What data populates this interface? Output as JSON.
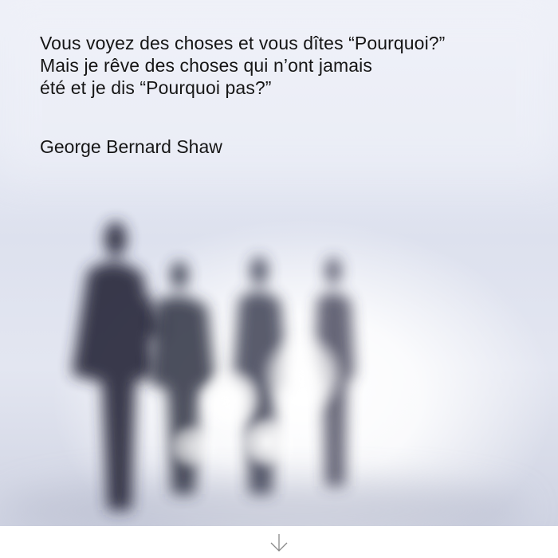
{
  "quote": {
    "lines": [
      "Vous voyez des choses et vous dîtes “Pourquoi?”",
      "Mais je rêve des choses qui n’ont jamais",
      "été et je dis “Pourquoi pas?”"
    ],
    "author": "George Bernard Shaw"
  },
  "icons": {
    "scroll": "arrow-down-icon"
  }
}
